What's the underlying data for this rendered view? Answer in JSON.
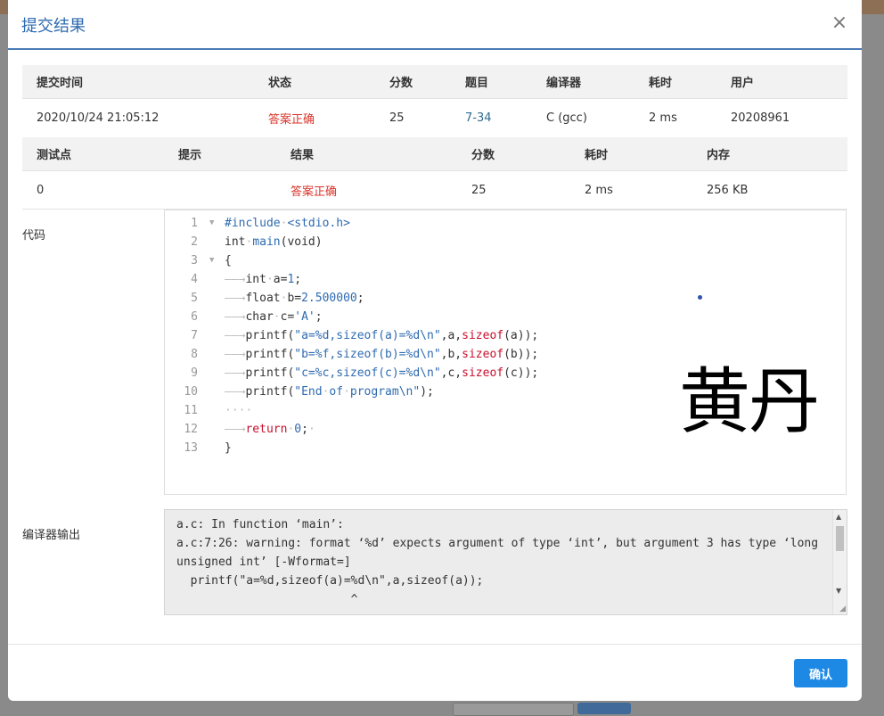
{
  "dialog": {
    "title": "提交结果",
    "close_glyph": "×",
    "confirm_label": "确认"
  },
  "submission": {
    "headers": [
      "提交时间",
      "状态",
      "分数",
      "题目",
      "编译器",
      "耗时",
      "用户"
    ],
    "row": {
      "time": "2020/10/24 21:05:12",
      "status": "答案正确",
      "score": "25",
      "problem": "7-34",
      "compiler": "C (gcc)",
      "elapsed": "2 ms",
      "user": "20208961"
    }
  },
  "testcases": {
    "headers": [
      "测试点",
      "提示",
      "结果",
      "分数",
      "耗时",
      "内存"
    ],
    "row": {
      "id": "0",
      "hint": "",
      "result": "答案正确",
      "score": "25",
      "elapsed": "2 ms",
      "memory": "256 KB"
    }
  },
  "code_section": {
    "label": "代码",
    "line_numbers": [
      "1",
      "2",
      "3",
      "4",
      "5",
      "6",
      "7",
      "8",
      "9",
      "10",
      "11",
      "12",
      "13"
    ],
    "handwritten_name": "黄丹"
  },
  "compiler_output": {
    "label": "编译器输出",
    "lines": [
      "a.c: In function ‘main’:",
      "a.c:7:26: warning: format ‘%d’ expects argument of type ‘int’, but argument 3 has type ‘long",
      "unsigned int’ [-Wformat=]",
      "  printf(\"a=%d,sizeof(a)=%d\\n\",a,sizeof(a));",
      "                         ^"
    ]
  },
  "colors": {
    "accent": "#2f6bb0",
    "success_red": "#d9352b",
    "confirm": "#1e88e5"
  }
}
